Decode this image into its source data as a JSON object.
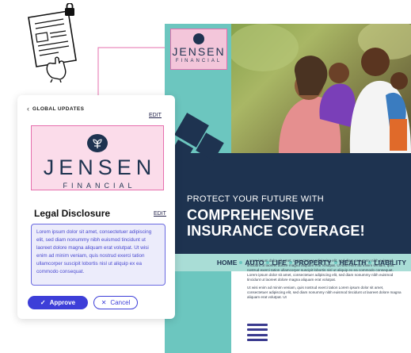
{
  "panel": {
    "back_label": "GLOBAL UPDATES",
    "logo_edit": "EDIT",
    "logo": {
      "name": "JENSEN",
      "subtitle": "FINANCIAL"
    },
    "section_title": "Legal Disclosure",
    "section_edit": "EDIT",
    "disclosure_text": "Lorem ipsum dolor sit amet, consectetuer adipiscing elit, sed diam nonummy nibh euismod tincidunt ut laoreet dolore magna aliquam erat volutpat. Ut wisi enim ad minim veniam, quis nostrud exerci tation ullamcorper suscipit lobortis nisl ut aliquip ex ea commodo consequat.",
    "approve_label": "Approve",
    "cancel_label": "Cancel"
  },
  "flyer": {
    "logo": {
      "name": "JENSEN",
      "subtitle": "FINANCIAL"
    },
    "tagline": "PROTECT YOUR FUTURE WITH",
    "headline": "COMPREHENSIVE INSURANCE COVERAGE!",
    "nav": [
      "HOME",
      "AUTO",
      "LIFE",
      "PROPERTY",
      "HEALTH",
      "LIABILITY"
    ],
    "body_p1": "Lorem ipsum dolor sit amet, consectetuer adipiscing elit, sed diam nonummy nibh euismod tincidunt ut laoreet dolore magna aliquam erat volutpat. Ut wisi enim ad minim veniam, quis nostrud exerci tation ullamcorper suscipit lobortis nisl ut aliquip ex ea commodo consequat. Lorem ipsum dolor sit amet, consectetuer adipiscing elit, sed diam nonummy nibh euismod tincidunt ut laoreet dolore magna aliquam erat volutpat.",
    "body_p2": "Ut wisi enim ad minim veniam, quis nostrud exerci tation Lorem ipsum dolor sit amet, consectetuer adipiscing elit, sed diam nonummy nibh euismod tincidunt ut laoreet dolore magna aliquam erat volutpat. Ut"
  },
  "colors": {
    "navy": "#1e3350",
    "teal": "#6cc6bf",
    "pink_highlight": "#fbdcea",
    "pink_border": "#e66fae",
    "purple_accent": "#3d3ed8"
  },
  "icons": [
    "chevron-left-icon",
    "check-icon",
    "close-icon",
    "plant-icon",
    "lock-icon",
    "document-icon",
    "hand-icon"
  ]
}
